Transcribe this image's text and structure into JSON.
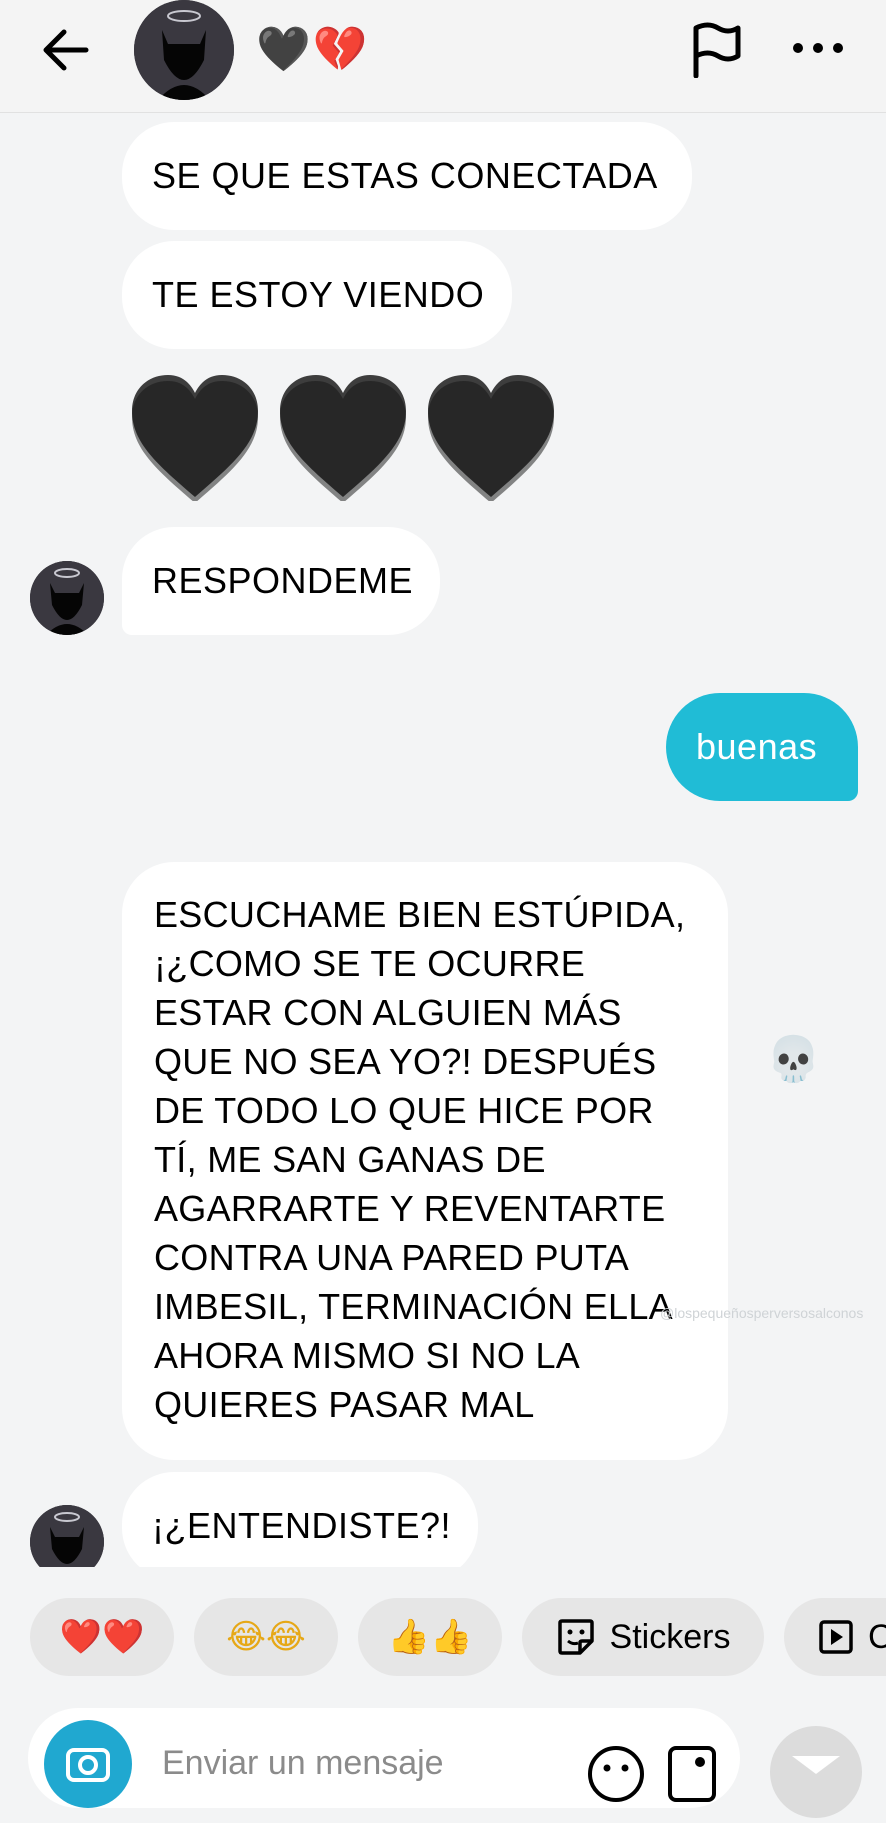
{
  "header": {
    "name_emoji": "🖤💔",
    "icons": [
      "back-arrow-icon",
      "flag-icon",
      "more-icon"
    ]
  },
  "messages": [
    {
      "text": "SE QUE ESTAS CONECTADA"
    },
    {
      "text": "TE ESTOY VIENDO"
    },
    {
      "text": "RESPONDEME"
    },
    {
      "text": "¡¿ENTENDISTE?!"
    }
  ],
  "outgoing": {
    "text": "buenas"
  },
  "long_message": {
    "lines": [
      "ESCUCHAME BIEN ESTÚPIDA,",
      "¡¿COMO SE TE OCURRE",
      "ESTAR CON ALGUIEN MÁS",
      "QUE NO SEA YO?! DESPUÉS",
      "DE TODO LO QUE HICE POR",
      "TÍ, ME SAN GANAS DE",
      "AGARRARTE Y REVENTARTE",
      "CONTRA UNA PARED PUTA",
      "IMBESIL, TERMINACIÓN ELLA",
      "AHORA MISMO SI NO LA",
      "QUIERES PASAR MAL"
    ],
    "reaction": "💀"
  },
  "watermark": "@lospequeñosperversosalconos",
  "quick_replies": [
    {
      "emoji": "❤️❤️"
    },
    {
      "emoji": "😂😂"
    },
    {
      "emoji": "👍👍"
    },
    {
      "label": "Stickers"
    },
    {
      "label": "C"
    }
  ],
  "composer": {
    "placeholder": "Enviar un mensaje"
  },
  "colors": {
    "outgoing": "#20bcd6",
    "incoming": "#ffffff",
    "background": "#f3f4f5"
  }
}
